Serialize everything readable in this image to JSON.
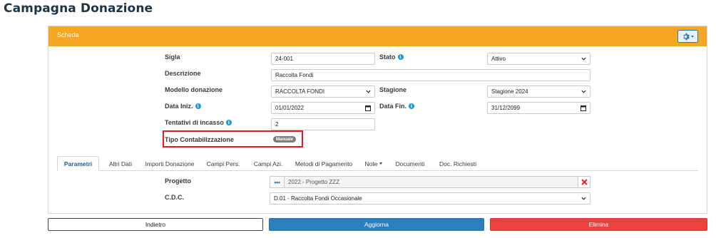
{
  "page": {
    "title": "Campagna Donazione"
  },
  "card": {
    "header_title": "Scheda",
    "gear_icon": "gear-icon"
  },
  "form": {
    "sigla": {
      "label": "Sigla",
      "value": "24-001"
    },
    "stato": {
      "label": "Stato",
      "value": "Attivo"
    },
    "descrizione": {
      "label": "Descrizione",
      "value": "Raccolta Fondi"
    },
    "modello": {
      "label": "Modello donazione",
      "value": "RACCOLTA FONDI"
    },
    "stagione": {
      "label": "Stagione",
      "value": "Stagione 2024"
    },
    "data_iniz": {
      "label": "Data Iniz.",
      "value": "01/01/2022"
    },
    "data_fin": {
      "label": "Data Fin.",
      "value": "31/12/2099"
    },
    "tentativi": {
      "label": "Tentativi di incasso",
      "value": "2"
    },
    "tipo_contab": {
      "label": "Tipo Contabilizzazione",
      "value": "Manuale"
    }
  },
  "tabs": [
    {
      "label": "Parametri",
      "active": true
    },
    {
      "label": "Altri Dati"
    },
    {
      "label": "Importi Donazione"
    },
    {
      "label": "Campi Pers."
    },
    {
      "label": "Campi Azi."
    },
    {
      "label": "Metodi di Pagamento"
    },
    {
      "label": "Note",
      "dropdown": true
    },
    {
      "label": "Documenti"
    },
    {
      "label": "Doc. Richiesti"
    }
  ],
  "parametri": {
    "progetto": {
      "label": "Progetto",
      "value": "2022 - Progetto ZZZ",
      "browse_label": "•••"
    },
    "cdc": {
      "label": "C.D.C.",
      "value": "D.01 - Raccolta Fondi Occasionale"
    }
  },
  "buttons": {
    "back": "Indietro",
    "update": "Aggiorna",
    "delete": "Elimina"
  },
  "colors": {
    "header": "#f5a623",
    "primary": "#2b7fbf",
    "danger": "#ef4040",
    "highlight": "#e01b24"
  }
}
